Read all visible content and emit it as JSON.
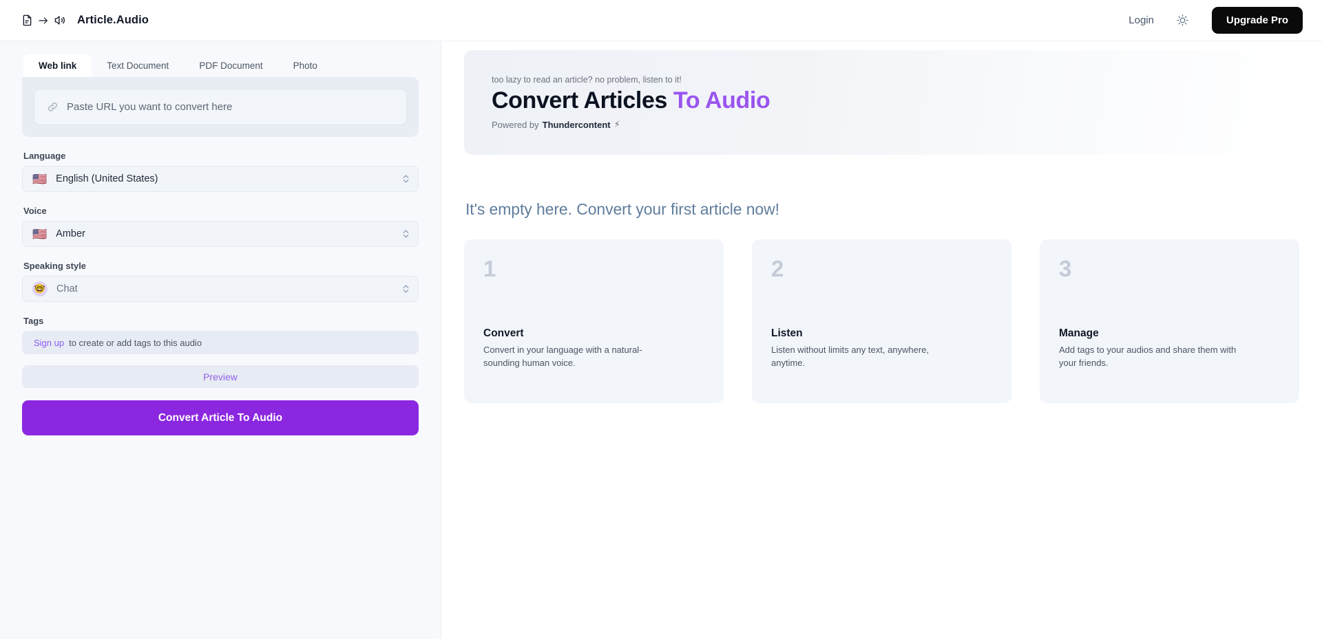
{
  "header": {
    "logo_text": "Article.Audio",
    "logo_icons": [
      "document-icon",
      "arrow-right-icon",
      "speaker-icon"
    ],
    "login_label": "Login",
    "theme_icon": "sun-icon",
    "upgrade_label": "Upgrade Pro",
    "upgrade_bg": "#0a0a0a"
  },
  "sidebar": {
    "tabs": [
      {
        "label": "Web link",
        "active": true
      },
      {
        "label": "Text Document",
        "active": false
      },
      {
        "label": "PDF Document",
        "active": false
      },
      {
        "label": "Photo",
        "active": false
      }
    ],
    "url_input": {
      "icon": "link-icon",
      "value": "",
      "placeholder": "Paste URL you want to convert here"
    },
    "language": {
      "label": "Language",
      "flag": "🇺🇸",
      "value": "English (United States)"
    },
    "voice": {
      "label": "Voice",
      "flag": "🇺🇸",
      "value": "Amber"
    },
    "speaking_style": {
      "label": "Speaking style",
      "emoji": "🤓",
      "value": "Chat"
    },
    "tags": {
      "label": "Tags",
      "link_label": "Sign up",
      "link_color": "#8b5cf6",
      "hint": "to create or add tags to this audio"
    },
    "preview_label": "Preview",
    "convert_label": "Convert Article To Audio",
    "convert_bg": "#8b27e0"
  },
  "main": {
    "hero": {
      "kicker": "too lazy to read an article? no problem, listen to it!",
      "title_dark": "Convert Articles",
      "title_accent": "To Audio",
      "accent_color": "#9a54ef",
      "powered_prefix": "Powered by",
      "powered_brand": "Thundercontent",
      "powered_icon": "⚡"
    },
    "empty_state_title": "It's empty here. Convert your first article now!",
    "cards": [
      {
        "number": "1",
        "title": "Convert",
        "desc": "Convert in your language with a natural-sounding human voice."
      },
      {
        "number": "2",
        "title": "Listen",
        "desc": "Listen without limits any text, anywhere, anytime."
      },
      {
        "number": "3",
        "title": "Manage",
        "desc": "Add tags to your audios and share them with your friends."
      }
    ]
  }
}
